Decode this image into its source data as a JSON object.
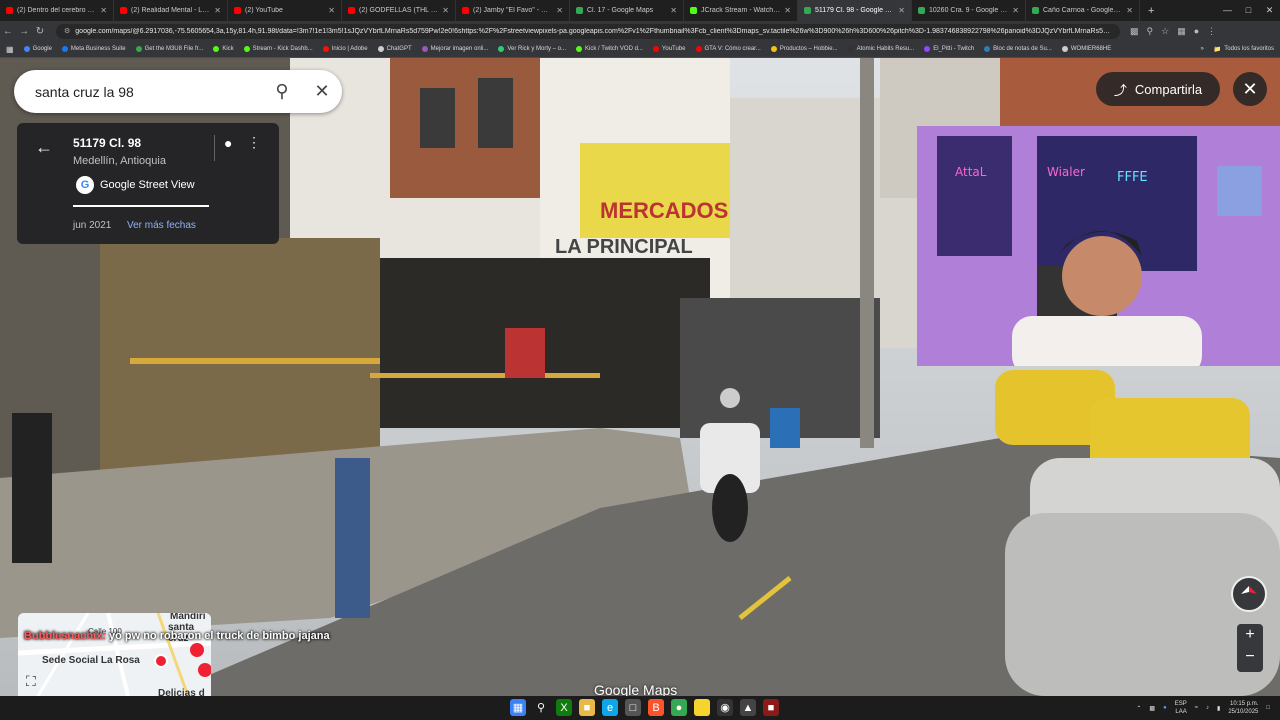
{
  "tabs": [
    {
      "title": "(2) Dentro del cerebro de GU",
      "color": "#ff0000"
    },
    {
      "title": "(2) Realidad Mental - Lo Que",
      "color": "#ff0000"
    },
    {
      "title": "(2) YouTube",
      "color": "#ff0000"
    },
    {
      "title": "(2) GODFELLAS (THL CYPHER)",
      "color": "#ff0000"
    },
    {
      "title": "(2) Jamby \"El Favo\" - Hoy",
      "color": "#ff0000"
    },
    {
      "title": "Cl. 17 - Google Maps",
      "color": "#34a853"
    },
    {
      "title": "JCrack Stream - Watch Live o",
      "color": "#53fc18"
    },
    {
      "title": "51179 Cl. 98 - Google Maps",
      "color": "#34a853"
    },
    {
      "title": "10260 Cra. 9 - Google Maps",
      "color": "#34a853"
    },
    {
      "title": "Caño Carnoa - Google Maps",
      "color": "#34a853"
    }
  ],
  "active_tab": 7,
  "url": "google.com/maps/@6.2917036,-75.5605654,3a,15y,81.4h,91.98t/data=!3m7!1e1!3m5!1sJQzVYbrfLMrnaRs5d759Pw!2e0!6shttps:%2F%2Fstreetviewpixels-pa.googleapis.com%2Fv1%2Fthumbnail%3Fcb_client%3Dmaps_sv.tactile%26w%3D900%26h%3D600%26pitch%3D-1.983746838922798%26panoid%3DJQzVYbrfLMrnaRs5d759Pw%26yaw%...",
  "bookmarks": [
    {
      "label": "Google",
      "color": "#4285f4"
    },
    {
      "label": "Meta Business Suite",
      "color": "#1877f2"
    },
    {
      "label": "Get the M3U8 File fr...",
      "color": "#34a853"
    },
    {
      "label": "Kick",
      "color": "#53fc18"
    },
    {
      "label": "Stream - Kick Dashb...",
      "color": "#53fc18"
    },
    {
      "label": "Inicio | Adobe",
      "color": "#fa0f00"
    },
    {
      "label": "ChatGPT",
      "color": "#cccccc"
    },
    {
      "label": "Mejorar imagen onli...",
      "color": "#9b59b6"
    },
    {
      "label": "Ver Rick y Morty – o...",
      "color": "#2ecc71"
    },
    {
      "label": "Kick / Twitch VOD d...",
      "color": "#53fc18"
    },
    {
      "label": "YouTube",
      "color": "#ff0000"
    },
    {
      "label": "GTA V: Cómo crear...",
      "color": "#ff0000"
    },
    {
      "label": "Productos – Hobbie...",
      "color": "#f1c40f"
    },
    {
      "label": "Atomic Habits Resu...",
      "color": "#333333"
    },
    {
      "label": "El_Pitti - Twitch",
      "color": "#9146ff"
    },
    {
      "label": "Bloc de notas de Su...",
      "color": "#2980b9"
    },
    {
      "label": "WOMIER68HE",
      "color": "#cccccc"
    }
  ],
  "bookmarks_all": "Todos los favoritos",
  "search": {
    "query": "santa cruz la 98"
  },
  "info_card": {
    "address": "51179 Cl. 98",
    "city": "Medellín, Antioquia",
    "source": "Google Street View",
    "date": "jun 2021",
    "more_dates": "Ver más fechas"
  },
  "share_label": "Compartirla",
  "minimap": {
    "labels": [
      "Mandirí",
      "santa cruz",
      "Calle 100",
      "Sede Social La Rosa",
      "Delicias d"
    ]
  },
  "chat": {
    "user": "Bubblesnachix:",
    "message": "yo pw no robaron el truck de bimbo jajana"
  },
  "watermark": "Google Maps",
  "tray": {
    "lang": "ESP",
    "region": "LAA",
    "time": "10:15 p.m.",
    "date": "25/10/2025"
  }
}
